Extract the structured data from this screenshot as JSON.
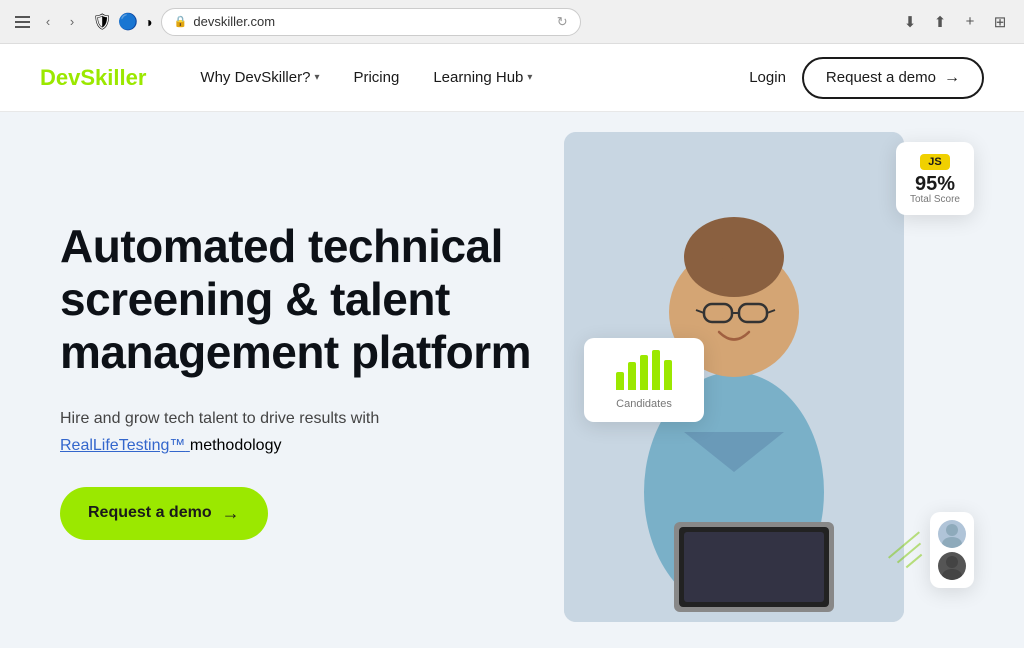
{
  "browser": {
    "url": "devskiller.com",
    "url_display": "devskiller.com",
    "lock_icon": "🔒"
  },
  "navbar": {
    "logo_dev": "Dev",
    "logo_skiller": "Skiller",
    "nav_items": [
      {
        "label": "Why DevSkiller?",
        "has_dropdown": true
      },
      {
        "label": "Pricing",
        "has_dropdown": false
      },
      {
        "label": "Learning Hub",
        "has_dropdown": true
      }
    ],
    "login_label": "Login",
    "demo_label": "Request a demo",
    "demo_arrow": "→"
  },
  "hero": {
    "title_line1": "Automated technical",
    "title_line2": "screening & talent",
    "title_line3": "management platform",
    "subtitle": "Hire and grow tech talent to drive results with",
    "link_text": "RealLifeTesting™",
    "subtitle_suffix": " methodology",
    "cta_label": "Request a demo",
    "cta_arrow": "→"
  },
  "hero_visual": {
    "candidates_label": "Candidates",
    "bars": [
      18,
      28,
      35,
      40,
      30
    ],
    "js_badge": "JS",
    "score_pct": "95%",
    "score_label": "Total Score"
  }
}
